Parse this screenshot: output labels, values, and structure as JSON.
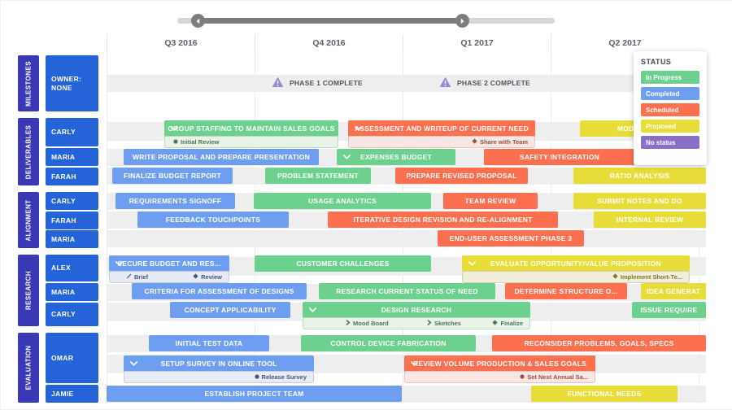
{
  "slider": {
    "left_handle_icon": "chevron-left-icon",
    "right_handle_icon": "chevron-right-icon"
  },
  "timeline": {
    "quarters": [
      "Q3 2016",
      "Q4 2016",
      "Q1 2017",
      "Q2 2017"
    ]
  },
  "status_legend": {
    "title": "STATUS",
    "items": [
      {
        "label": "In Progress",
        "color": "#6cd18e"
      },
      {
        "label": "Completed",
        "color": "#6e9eef"
      },
      {
        "label": "Scheduled",
        "color": "#fc6f4f"
      },
      {
        "label": "Proposed",
        "color": "#e8dd38"
      },
      {
        "label": "No status",
        "color": "#8a6fc9"
      }
    ]
  },
  "groups": [
    {
      "name": "MILESTONES",
      "owners": [
        "OWNER:\nNONE"
      ]
    },
    {
      "name": "DELIVERABLES",
      "owners": [
        "CARLY",
        "MARIA",
        "FARAH"
      ]
    },
    {
      "name": "ALIGNMENT",
      "owners": [
        "CARLY",
        "FARAH",
        "MARIA"
      ]
    },
    {
      "name": "RESEARCH",
      "owners": [
        "ALEX",
        "MARIA",
        "CARLY"
      ]
    },
    {
      "name": "EVALUATION",
      "owners": [
        "OMAR",
        "JAMIE"
      ]
    }
  ],
  "milestones": [
    {
      "label": "PHASE 1 COMPLETE",
      "icon": "warning-triangle-icon"
    },
    {
      "label": "PHASE 2 COMPLETE",
      "icon": "warning-triangle-icon"
    }
  ],
  "bars": [
    {
      "label": "GROUP STAFFING TO MAINTAIN SALES GOALS",
      "status": "In Progress",
      "expandable": true
    },
    {
      "label": "ASSESSMENT AND WRITEUP OF CURRENT NEED",
      "status": "Scheduled",
      "expandable": true
    },
    {
      "label": "MODELING BA",
      "status": "Proposed",
      "expandable": false
    },
    {
      "label": "WRITE PROPOSAL AND PREPARE PRESENTATION",
      "status": "Completed",
      "expandable": false
    },
    {
      "label": "EXPENSES BUDGET",
      "status": "In Progress",
      "expandable": true
    },
    {
      "label": "SAFETY INTEGRATION",
      "status": "Scheduled",
      "expandable": false
    },
    {
      "label": "FINALIZE BUDGET REPORT",
      "status": "Completed",
      "expandable": false
    },
    {
      "label": "PROBLEM STATEMENT",
      "status": "In Progress",
      "expandable": false
    },
    {
      "label": "PREPARE REVISED PROPOSAL",
      "status": "Scheduled",
      "expandable": false
    },
    {
      "label": "RATIO ANALYSIS",
      "status": "Proposed",
      "expandable": false
    },
    {
      "label": "REQUIREMENTS SIGNOFF",
      "status": "Completed",
      "expandable": false
    },
    {
      "label": "USAGE ANALYTICS",
      "status": "In Progress",
      "expandable": false
    },
    {
      "label": "TEAM REVIEW",
      "status": "Scheduled",
      "expandable": false
    },
    {
      "label": "SUBMIT NOTES AND DO",
      "status": "Proposed",
      "expandable": false
    },
    {
      "label": "FEEDBACK TOUCHPOINTS",
      "status": "Completed",
      "expandable": false
    },
    {
      "label": "ITERATIVE DESIGN REVISION AND RE-ALIGNMENT",
      "status": "Scheduled",
      "expandable": false
    },
    {
      "label": "INTERNAL REVIEW",
      "status": "Proposed",
      "expandable": false
    },
    {
      "label": "END-USER ASSESSMENT PHASE 3",
      "status": "Scheduled",
      "expandable": false
    },
    {
      "label": "SECURE BUDGET AND RES...",
      "status": "Completed",
      "expandable": true
    },
    {
      "label": "CUSTOMER CHALLENGES",
      "status": "In Progress",
      "expandable": false
    },
    {
      "label": "EVALUATE OPPORTUNITY/VALUE PROPOSITION",
      "status": "Proposed",
      "expandable": true
    },
    {
      "label": "CRITERIA FOR ASSESSMENT OF DESIGNS",
      "status": "Completed",
      "expandable": false
    },
    {
      "label": "RESEARCH CURRENT STATUS OF NEED",
      "status": "In Progress",
      "expandable": false
    },
    {
      "label": "DETERMINE STRUCTURE O...",
      "status": "Scheduled",
      "expandable": false
    },
    {
      "label": "IDEA GENERAT",
      "status": "Proposed",
      "expandable": false
    },
    {
      "label": "CONCEPT APPLICABILITY",
      "status": "Completed",
      "expandable": false
    },
    {
      "label": "DESIGN RESEARCH",
      "status": "In Progress",
      "expandable": true
    },
    {
      "label": "ISSUE REQUIRE",
      "status": "In Progress",
      "expandable": false
    },
    {
      "label": "INITIAL TEST DATA",
      "status": "Completed",
      "expandable": false
    },
    {
      "label": "CONTROL DEVICE FABRICATION",
      "status": "In Progress",
      "expandable": false
    },
    {
      "label": "RECONSIDER PROBLEMS, GOALS, SPECS",
      "status": "Scheduled",
      "expandable": false
    },
    {
      "label": "SETUP SURVEY IN ONLINE TOOL",
      "status": "Completed",
      "expandable": true
    },
    {
      "label": "REVIEW VOLUME PRODUCTION & SALES GOALS",
      "status": "Scheduled",
      "expandable": true
    },
    {
      "label": "ESTABLISH PROJECT TEAM",
      "status": "Completed",
      "expandable": false
    },
    {
      "label": "FUNCTIONAL NEEDS",
      "status": "Proposed",
      "expandable": false
    }
  ],
  "subitems": [
    {
      "label": "Initial Review",
      "icon": "dot-icon"
    },
    {
      "label": "Share with Team",
      "icon": "diamond-icon"
    },
    {
      "label": "Brief",
      "icon": "pencil-icon"
    },
    {
      "label": "Review",
      "icon": "diamond-icon"
    },
    {
      "label": "Implement Short-Te...",
      "icon": "diamond-icon"
    },
    {
      "label": "Mood Board",
      "icon": "chevron-right-icon"
    },
    {
      "label": "Sketches",
      "icon": "chevron-right-icon"
    },
    {
      "label": "Finalize",
      "icon": "diamond-icon"
    },
    {
      "label": "Release Survey",
      "icon": "dot-icon"
    },
    {
      "label": "Set Next Annual Sa...",
      "icon": "dot-icon"
    }
  ]
}
